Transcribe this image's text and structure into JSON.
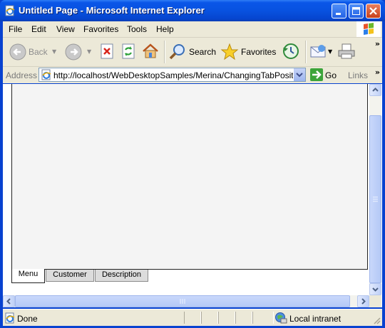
{
  "window": {
    "title": "Untitled Page - Microsoft Internet Explorer"
  },
  "menu": {
    "items": [
      "File",
      "Edit",
      "View",
      "Favorites",
      "Tools",
      "Help"
    ]
  },
  "toolbar": {
    "back_label": "Back",
    "search_label": "Search",
    "favorites_label": "Favorites",
    "overflow": "»"
  },
  "address": {
    "label": "Address",
    "url": "http://localhost/WebDesktopSamples/Merina/ChangingTabPosition.aspx",
    "go_label": "Go",
    "links_label": "Links"
  },
  "tabs": [
    {
      "label": "Menu",
      "active": true
    },
    {
      "label": "Customer",
      "active": false
    },
    {
      "label": "Description",
      "active": false
    }
  ],
  "status": {
    "text": "Done",
    "zone": "Local intranet"
  },
  "colors": {
    "titlebar": "#0a56e8",
    "chrome": "#ece9d8",
    "panel": "#f4f4f4",
    "scroll_thumb": "#c9d8fb"
  }
}
